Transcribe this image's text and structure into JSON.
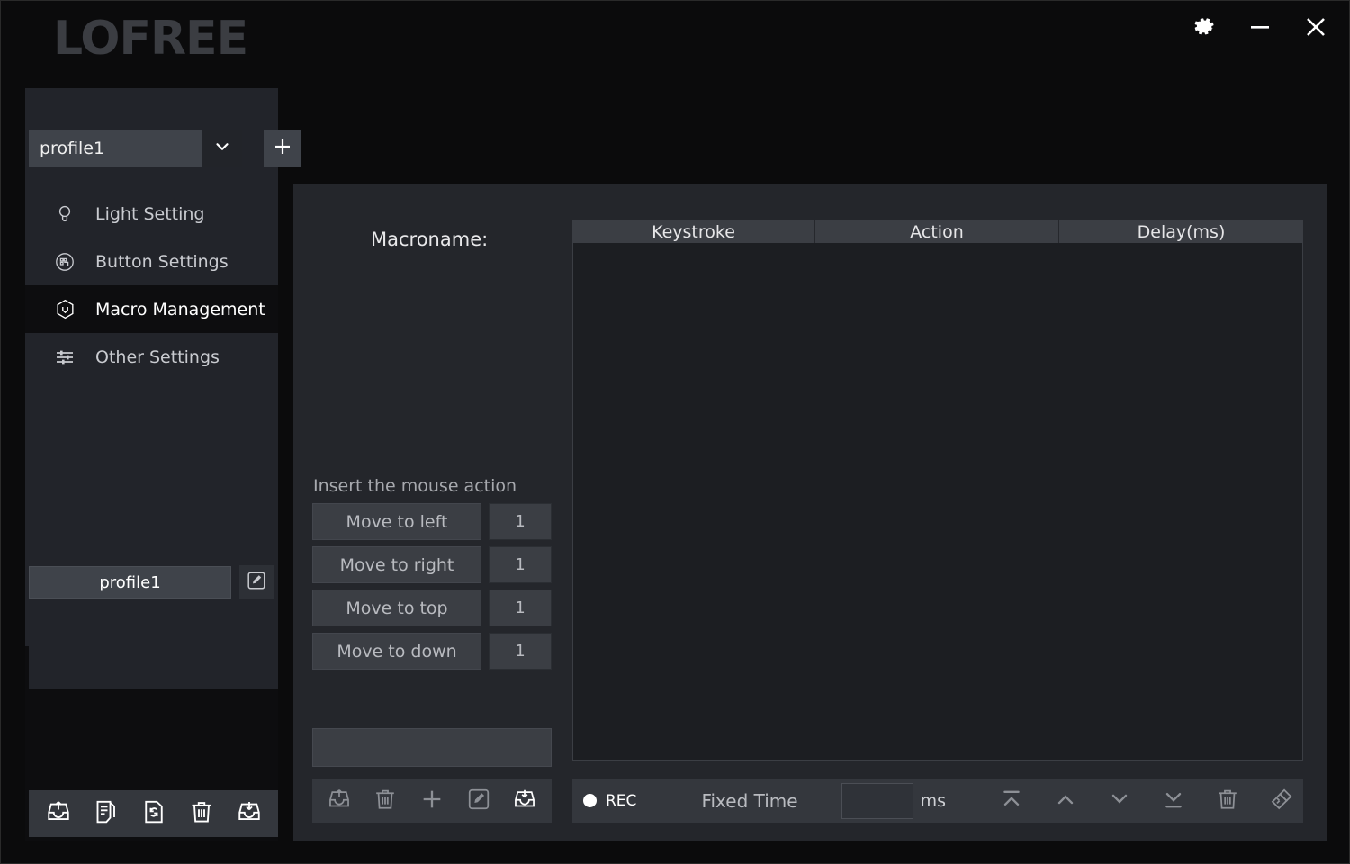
{
  "window": {
    "brand": "LOFREE",
    "controls": [
      {
        "name": "settings-button",
        "icon": "gear-icon"
      },
      {
        "name": "minimize-button",
        "icon": "minimize-icon"
      },
      {
        "name": "close-button",
        "icon": "close-icon"
      }
    ]
  },
  "sidebar": {
    "profile_select": {
      "value": "profile1",
      "caret_icon": "chevron-down-icon",
      "add_icon": "plus-icon"
    },
    "items": [
      {
        "label": "Light Setting",
        "icon": "bulb-icon",
        "selected": false
      },
      {
        "label": "Button Settings",
        "icon": "keypad-circle-icon",
        "selected": false
      },
      {
        "label": "Macro Management",
        "icon": "cube-icon",
        "selected": true
      },
      {
        "label": "Other Settings",
        "icon": "sliders-icon",
        "selected": false
      }
    ],
    "profile_list": [
      {
        "label": "profile1",
        "edit_icon": "edit-square-icon"
      }
    ],
    "toolbar": [
      {
        "name": "export-profile-button",
        "icon": "export-tray-icon"
      },
      {
        "name": "duplicate-profile-button",
        "icon": "document-copy-icon"
      },
      {
        "name": "reset-profile-button",
        "icon": "file-refresh-icon"
      },
      {
        "name": "delete-profile-button",
        "icon": "trash-icon"
      },
      {
        "name": "import-profile-button",
        "icon": "import-tray-icon"
      }
    ]
  },
  "main": {
    "macroname_label": "Macroname:",
    "mouse_section": {
      "title": "Insert the mouse action",
      "actions": [
        {
          "label": "Move to left",
          "value": "1"
        },
        {
          "label": "Move to right",
          "value": "1"
        },
        {
          "label": "Move to top",
          "value": "1"
        },
        {
          "label": "Move to down",
          "value": "1"
        }
      ]
    },
    "macro_list": {
      "value": ""
    },
    "macro_toolbar": [
      {
        "name": "export-macro-button",
        "icon": "export-tray-icon"
      },
      {
        "name": "delete-macro-button",
        "icon": "trash-icon"
      },
      {
        "name": "add-macro-button",
        "icon": "plus-icon"
      },
      {
        "name": "edit-macro-button",
        "icon": "edit-square-icon"
      },
      {
        "name": "import-macro-button",
        "icon": "import-tray-icon"
      }
    ],
    "table": {
      "columns": [
        "Keystroke",
        "Action",
        "Delay(ms)"
      ],
      "rows": []
    },
    "recbar": {
      "rec_label": "REC",
      "fixed_time_label": "Fixed Time",
      "delay_value": "",
      "unit_label": "ms",
      "icons": [
        {
          "name": "move-to-top-button",
          "icon": "move-to-top-icon"
        },
        {
          "name": "move-up-button",
          "icon": "chevron-up-icon"
        },
        {
          "name": "move-down-button",
          "icon": "chevron-down-icon"
        },
        {
          "name": "move-to-bottom-button",
          "icon": "move-to-bottom-icon"
        },
        {
          "name": "delete-row-button",
          "icon": "trash-icon"
        },
        {
          "name": "clear-all-button",
          "icon": "brush-icon"
        }
      ]
    }
  },
  "colors": {
    "window_bg": "#0b0b0c",
    "panel_bg": "#24262b",
    "sidebar_bg": "#22242a",
    "selected_bg": "#0d0d0f",
    "control_bg": "#3b3e44",
    "toolbar_bg": "#34373d",
    "text_primary": "#ffffff",
    "text_secondary": "#b9bbc0",
    "logo_color": "#3b3d42"
  }
}
